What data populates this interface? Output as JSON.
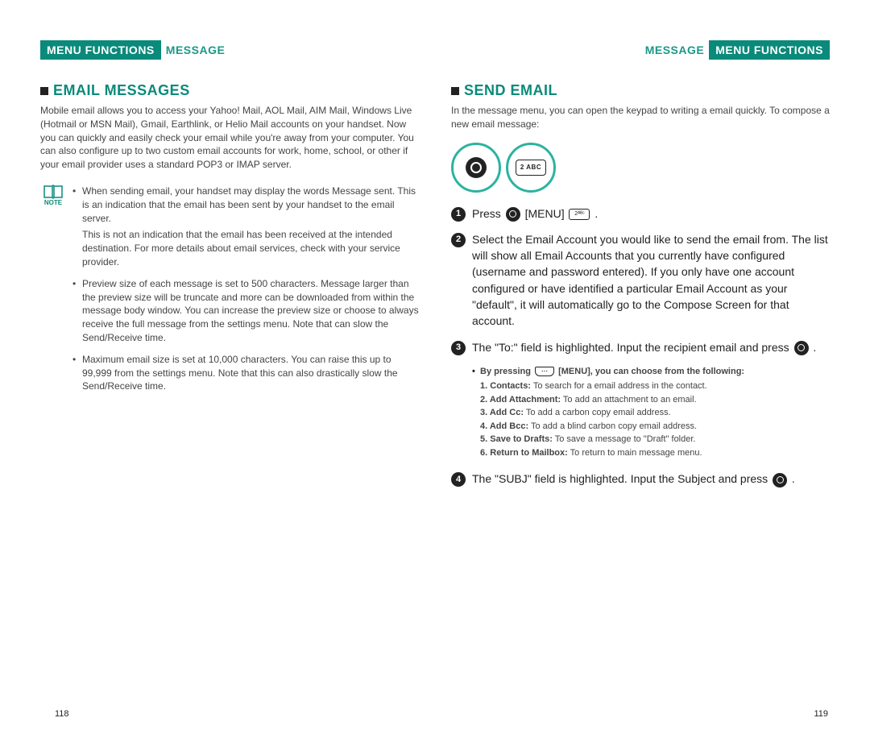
{
  "left": {
    "tab": "MENU FUNCTIONS",
    "sub": "MESSAGE",
    "heading": "EMAIL MESSAGES",
    "intro": "Mobile email allows you to access your Yahoo! Mail, AOL Mail, AIM Mail, Windows Live (Hotmail or MSN Mail), Gmail, Earthlink, or Helio Mail accounts on your handset.  Now you can quickly and easily check your email while you're away from your computer.  You can also configure up to two custom email accounts for work, home, school, or other if your email provider uses a standard POP3 or IMAP server.",
    "note_label": "NOTE",
    "notes": {
      "b1": "When sending email, your handset may display the words Message sent. This is an indication that the email has been sent by your handset to the email server.",
      "b1sub": "This is not an indication that the email has been received at the intended destination. For more details about email services, check with your service provider.",
      "b2": "Preview size of each message is set to 500 characters. Message larger than the preview size will be truncate and more can be downloaded from within the message body window.  You can increase the preview size or choose to always receive the full message from the settings menu. Note that can slow the Send/Receive time.",
      "b3": "Maximum email size is set at 10,000 characters. You can raise this up to 99,999 from the settings menu.  Note that this can also drastically slow the Send/Receive time."
    },
    "page": "118"
  },
  "right": {
    "tab": "MENU FUNCTIONS",
    "sub": "MESSAGE",
    "heading": "SEND EMAIL",
    "intro": "In the message menu, you can open the keypad to writing a email quickly. To compose a new email message:",
    "key2_text": "2 ABC",
    "steps": {
      "s1_a": "Press ",
      "s1_b": " [MENU] ",
      "s1_c": " .",
      "s2": "Select the Email Account you would like to send the email from.  The list will show all Email Accounts that you currently have configured (username and password entered).  If you only have one account configured or have identified a particular Email Account as your \"default\", it will automatically go to the Compose Screen for that account.",
      "s3_a": "The \"To:\" field is highlighted. Input the recipient email and press ",
      "s3_b": " .",
      "s4_a": "The \"SUBJ\" field is highlighted. Input the Subject and press ",
      "s4_b": " ."
    },
    "menu": {
      "intro_a": "By pressing ",
      "intro_b": " [MENU], you can choose from the following:",
      "items": [
        {
          "n": "1.",
          "b": "Contacts:",
          "t": " To search for a email address in the contact."
        },
        {
          "n": "2.",
          "b": "Add Attachment:",
          "t": " To add an attachment to an email."
        },
        {
          "n": "3.",
          "b": "Add Cc:",
          "t": " To add a carbon copy email address."
        },
        {
          "n": "4.",
          "b": "Add Bcc:",
          "t": " To add a blind carbon copy email address."
        },
        {
          "n": "5.",
          "b": "Save to Drafts:",
          "t": " To save a message to \"Draft\" folder."
        },
        {
          "n": "6.",
          "b": "Return to Mailbox:",
          "t": " To return to main message menu."
        }
      ]
    },
    "page": "119"
  }
}
